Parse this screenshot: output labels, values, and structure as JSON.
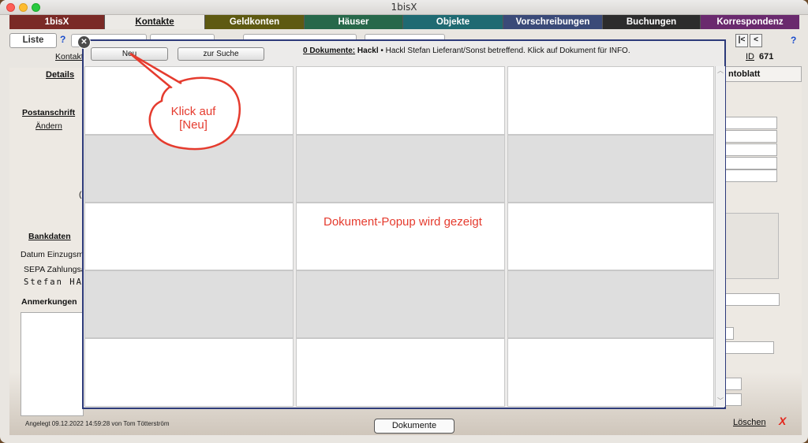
{
  "window": {
    "title": "1bisX"
  },
  "tabs": [
    {
      "label": "1bisX",
      "color": "#7a2a26"
    },
    {
      "label": "Kontakte",
      "color": "#eceae6"
    },
    {
      "label": "Geldkonten",
      "color": "#5e5a12"
    },
    {
      "label": "Häuser",
      "color": "#27684a"
    },
    {
      "label": "Objekte",
      "color": "#1f6a72"
    },
    {
      "label": "Vorschreibungen",
      "color": "#3a4a78"
    },
    {
      "label": "Buchungen",
      "color": "#2c2c2c"
    },
    {
      "label": "Korrespondenz",
      "color": "#6a2a6e"
    }
  ],
  "topbar": {
    "liste_label": "Liste",
    "help": "?",
    "nav_first": "|<",
    "nav_prev": "<",
    "help_right": "?"
  },
  "record": {
    "kontakt_link": "Kontakt",
    "id_label": "ID",
    "id_value": "671"
  },
  "left": {
    "details": "Details",
    "postanschrift": "Postanschrift",
    "aendern": "Ändern",
    "bankdaten": "Bankdaten",
    "datum": "Datum Einzugsm",
    "sepa": "SEPA Zahlungsa",
    "name_mono": "Stefan HAC",
    "anmerkungen": "Anmerkungen"
  },
  "right": {
    "kontoblatt": "ntoblatt"
  },
  "popup": {
    "close": "✕",
    "neu_label": "Neu",
    "suche_label": "zur Suche",
    "count": "0 Dokumente:",
    "name": "Hackl",
    "info": " • Hackl Stefan Lieferant/Sonst betreffend. Klick auf Dokument für INFO."
  },
  "annotations": {
    "callout": "Klick auf\n[Neu]",
    "center": "Dokument-Popup wird gezeigt",
    "color": "#e53b2e"
  },
  "footer": {
    "created": "Angelegt 09.12.2022 14:59:28 von Tom Tötterström",
    "dokumente_label": "Dokumente",
    "loeschen_label": "Löschen",
    "delete_x": "X"
  }
}
